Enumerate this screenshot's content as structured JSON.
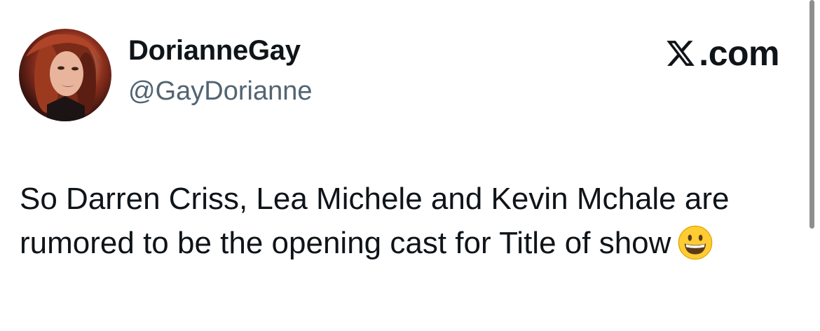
{
  "tweet": {
    "author": {
      "display_name": "DorianneGay",
      "handle": "@GayDorianne"
    },
    "brand": {
      "text": ".com",
      "icon": "x-logo-icon"
    },
    "text": "So Darren Criss, Lea Michele and Kevin Mchale are rumored to be the opening cast for Title of show",
    "emoji": "grinning-face-icon"
  },
  "colors": {
    "text_primary": "#0f1419",
    "text_secondary": "#536471",
    "emoji_yellow": "#ffcc33",
    "scrollbar": "#8e8e8e"
  }
}
